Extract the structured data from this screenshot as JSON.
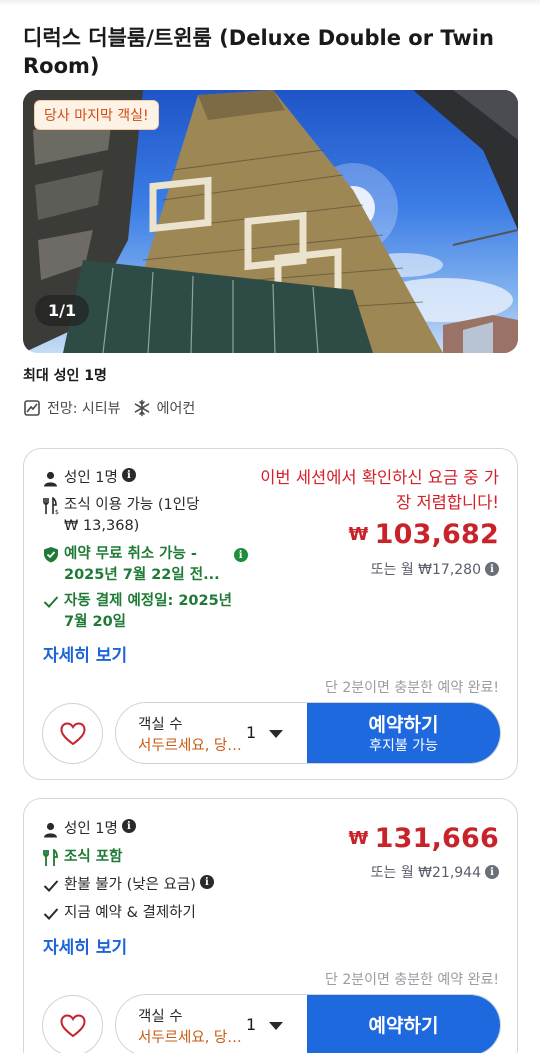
{
  "room": {
    "title": "디럭스 더블룸/트윈룸 (Deluxe Double or Twin Room)",
    "badge": "당사 마지막 객실!",
    "photo_counter": "1/1",
    "max_occupancy": "최대 성인 1명",
    "amenities": [
      {
        "icon": "city-view-icon",
        "label": "전망: 시티뷰"
      },
      {
        "icon": "snowflake-icon",
        "label": "에어컨"
      }
    ]
  },
  "offers": [
    {
      "occupancy": "성인 1명",
      "breakfast_line1": "조식 이용 가능 (1인당",
      "breakfast_line2": "₩ 13,368)",
      "cancellation_line1": "예약 무료 취소 가능 -",
      "cancellation_line2": "2025년 7월 22일 전...",
      "payment_line1": "자동 결제 예정일: 2025년",
      "payment_line2": "7월 20일",
      "details_link": "자세히 보기",
      "cheapest_note": "이번 세션에서 확인하신 요금 중 가장 저렴합니다!",
      "currency": "₩",
      "price": "103,682",
      "monthly": "또는 월 ₩17,280",
      "quick_note": "단 2분이면 충분한 예약 완료!",
      "rooms_label": "객실 수",
      "rooms_hint": "서두르세요, 당사 마지막 객실!",
      "rooms_value": "1",
      "book_label": "예약하기",
      "book_sub": "후지불 가능"
    },
    {
      "occupancy": "성인 1명",
      "breakfast": "조식 포함",
      "refund": "환불 불가 (낮은 요금)",
      "pay_now": "지금 예약 & 결제하기",
      "details_link": "자세히 보기",
      "currency": "₩",
      "price": "131,666",
      "monthly": "또는 월 ₩21,944",
      "quick_note": "단 2분이면 충분한 예약 완료!",
      "rooms_label": "객실 수",
      "rooms_hint": "서두르세요, 당사 마지막 객실!",
      "rooms_value": "1",
      "book_label": "예약하기"
    }
  ],
  "colors": {
    "accent_blue": "#1f69df",
    "price_red": "#c8232b",
    "green": "#1e7a34",
    "hint_orange": "#c65b12"
  }
}
